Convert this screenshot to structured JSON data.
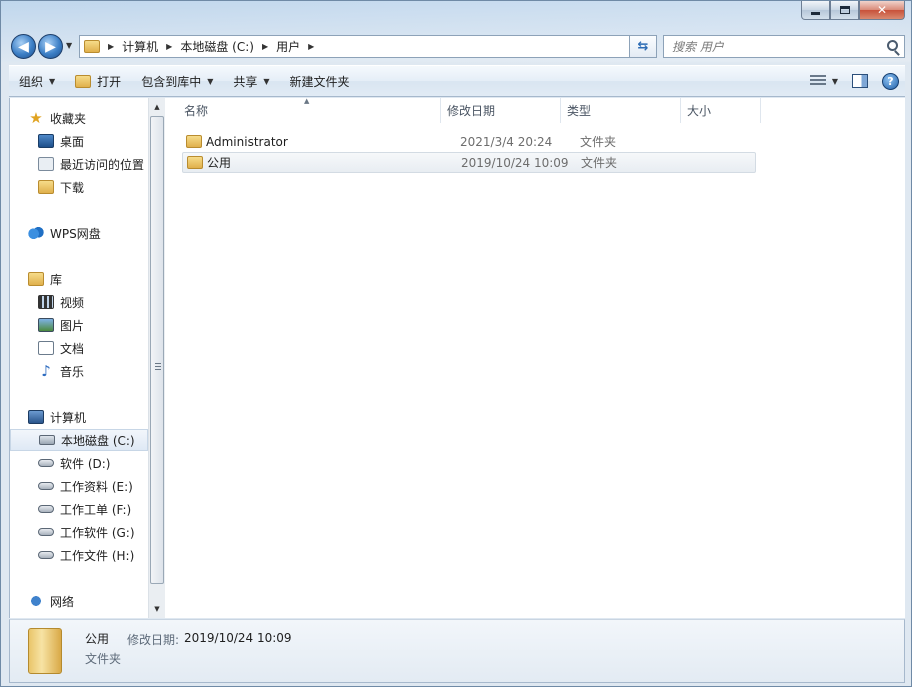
{
  "window": {
    "minimize_glyph": "",
    "maximize_glyph": "",
    "close_glyph": "✕"
  },
  "address": {
    "crumbs": [
      "计算机",
      "本地磁盘 (C:)",
      "用户"
    ]
  },
  "search": {
    "placeholder": "搜索 用户"
  },
  "toolbar": {
    "organize": "组织",
    "open": "打开",
    "include_in_library": "包含到库中",
    "share": "共享",
    "new_folder": "新建文件夹"
  },
  "navpane": {
    "favorites": "收藏夹",
    "desktop": "桌面",
    "recent": "最近访问的位置",
    "downloads": "下载",
    "wps": "WPS网盘",
    "libraries": "库",
    "videos": "视频",
    "pictures": "图片",
    "documents": "文档",
    "music": "音乐",
    "computer": "计算机",
    "drive_c": "本地磁盘 (C:)",
    "drive_d": "软件 (D:)",
    "drive_e": "工作资料 (E:)",
    "drive_f": "工作工单 (F:)",
    "drive_g": "工作软件 (G:)",
    "drive_h": "工作文件 (H:)",
    "network": "网络"
  },
  "columns": {
    "name": "名称",
    "date": "修改日期",
    "type": "类型",
    "size": "大小"
  },
  "files": [
    {
      "name": "Administrator",
      "date": "2021/3/4 20:24",
      "type": "文件夹"
    },
    {
      "name": "公用",
      "date": "2019/10/24 10:09",
      "type": "文件夹"
    }
  ],
  "details": {
    "name": "公用",
    "date_label": "修改日期:",
    "date_value": "2019/10/24 10:09",
    "type": "文件夹"
  },
  "colors": {
    "selection": "#e8edf2",
    "toolbar": "#e1ebf5",
    "accent": "#2c6bb4"
  }
}
